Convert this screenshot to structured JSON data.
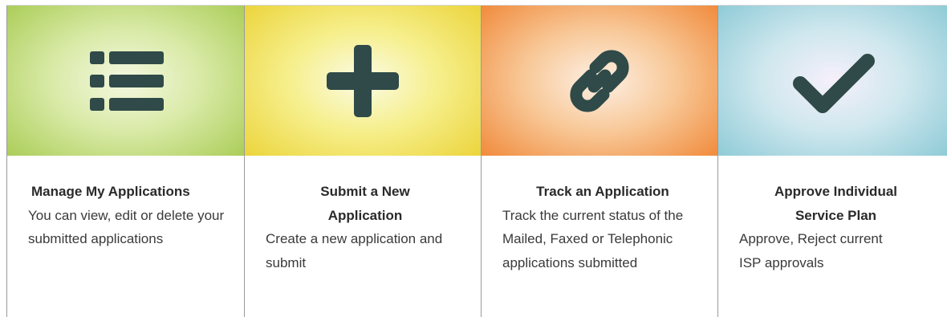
{
  "tiles": [
    {
      "title": "Manage My Applications",
      "description": "You can view, edit or delete your submitted applications",
      "icon": "list-icon",
      "banner_color": "#a9cc55"
    },
    {
      "title": "Submit a New Application",
      "description": "Create a new application and submit",
      "icon": "plus-icon",
      "banner_color": "#ebd338"
    },
    {
      "title": "Track an Application",
      "description": "Track the current status of the Mailed, Faxed or Telephonic applications submitted",
      "icon": "link-icon",
      "banner_color": "#f08838"
    },
    {
      "title": "Approve Individual Service Plan",
      "description": "Approve, Reject current ISP approvals",
      "icon": "checkmark-icon",
      "banner_color": "#8ccad6"
    }
  ],
  "colors": {
    "icon": "#2f4a48",
    "title_text": "#2a2a2a",
    "body_text": "#3a3a3a"
  }
}
